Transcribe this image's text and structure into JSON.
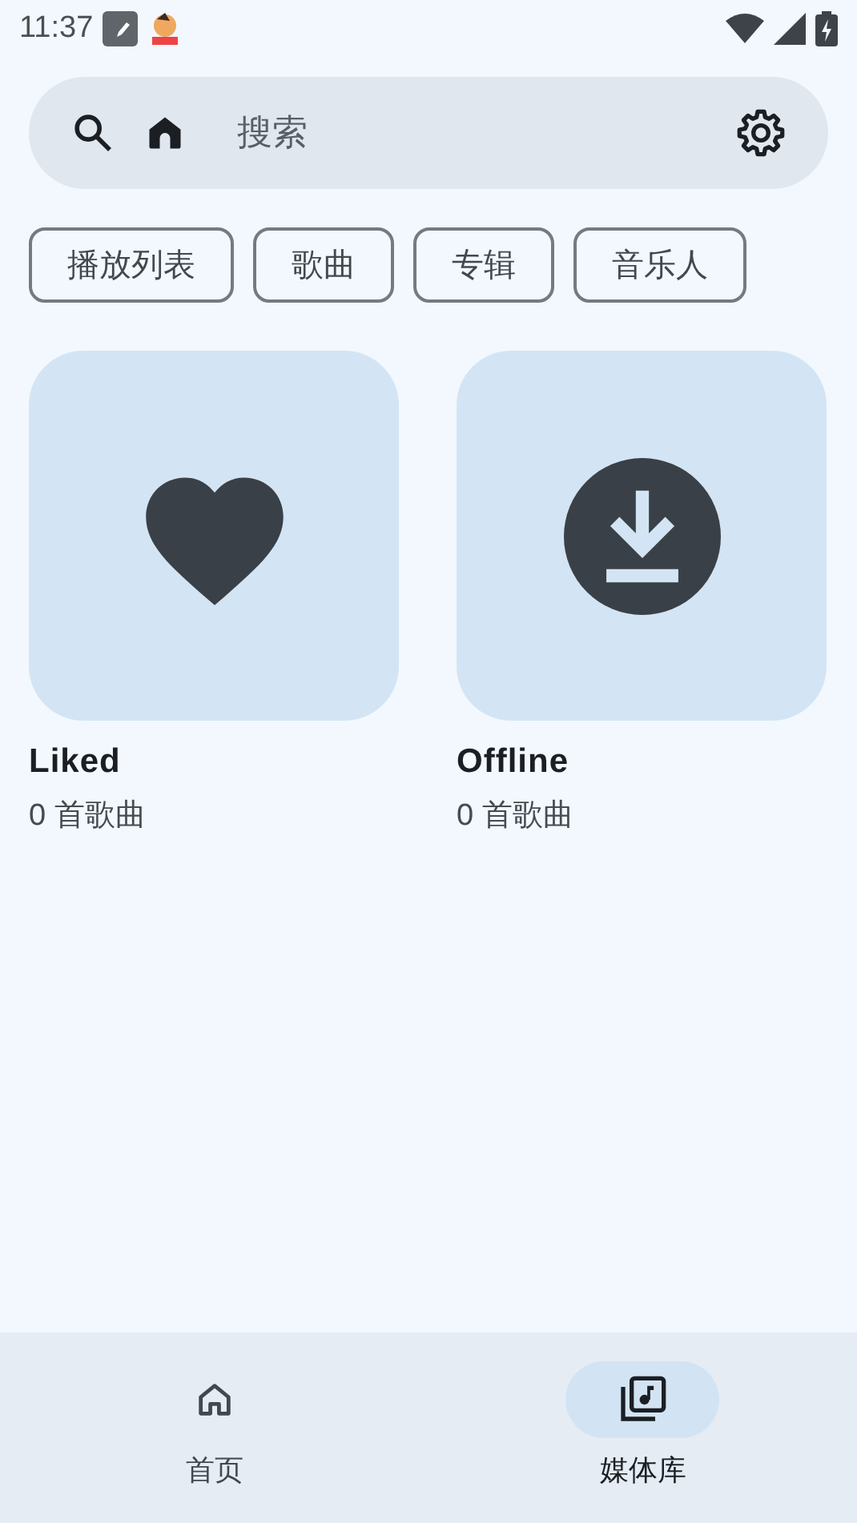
{
  "status_bar": {
    "time": "11:37"
  },
  "search": {
    "placeholder": "搜索"
  },
  "chips": [
    {
      "label": "播放列表"
    },
    {
      "label": "歌曲"
    },
    {
      "label": "专辑"
    },
    {
      "label": "音乐人"
    }
  ],
  "cards": [
    {
      "kind": "liked",
      "title": "Liked",
      "subtitle": "0 首歌曲"
    },
    {
      "kind": "offline",
      "title": "Offline",
      "subtitle": "0 首歌曲"
    }
  ],
  "nav": [
    {
      "kind": "home",
      "label": "首页",
      "selected": false
    },
    {
      "kind": "library",
      "label": "媒体库",
      "selected": true
    }
  ]
}
